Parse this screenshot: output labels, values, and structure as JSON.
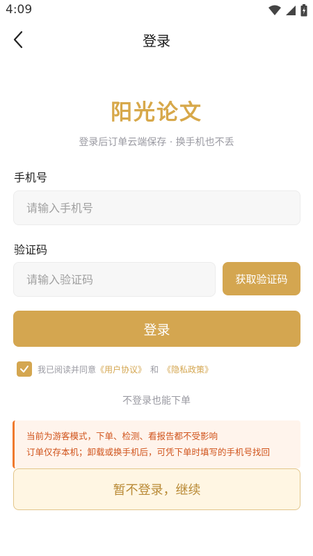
{
  "status_bar": {
    "time": "4:09"
  },
  "nav": {
    "title": "登录"
  },
  "brand": {
    "app_name": "阳光论文",
    "subtitle": "登录后订单云端保存 · 换手机也不丢"
  },
  "phone": {
    "label": "手机号",
    "placeholder": "请输入手机号",
    "value": ""
  },
  "code": {
    "label": "验证码",
    "placeholder": "请输入验证码",
    "value": "",
    "get_code_label": "获取验证码"
  },
  "login_button": "登录",
  "agreement": {
    "checked": true,
    "prefix": "我已阅读并同意",
    "user_agreement": "《用户协议》",
    "and": "和",
    "privacy_policy": "《隐私政策》"
  },
  "guest_hint": "不登录也能下单",
  "notice": {
    "line1": "当前为游客模式，下单、检测、看报告都不受影响",
    "line2": "订单仅存本机；卸载或换手机后，可凭下单时填写的手机号找回"
  },
  "skip_button": "暂不登录，继续",
  "colors": {
    "accent": "#D4A650",
    "notice_text": "#D0541C",
    "notice_border": "#F07A2E"
  }
}
